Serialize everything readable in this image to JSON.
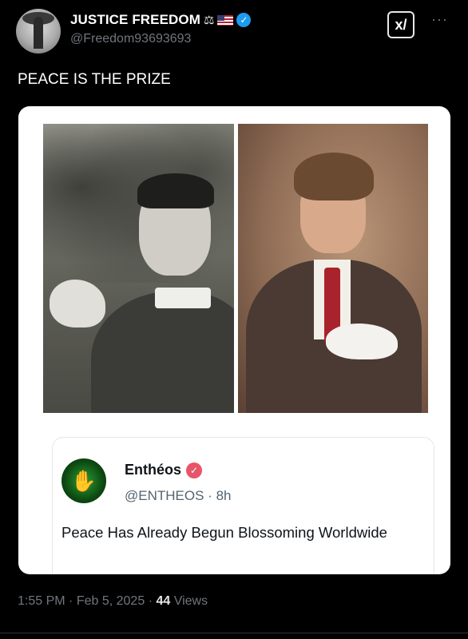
{
  "author": {
    "name": "JUSTICE FREEDOM",
    "name_emojis": [
      "scales-icon",
      "us-flag-icon"
    ],
    "handle": "@Freedom93693693",
    "verified": true,
    "verified_color": "#1d9bf0"
  },
  "header_actions": {
    "grok_label": "x/",
    "more_label": "···"
  },
  "tweet": {
    "text": "PEACE IS THE PRIZE",
    "images": [
      "portrait-man-with-dove-bw",
      "portrait-man-in-suit-with-dove"
    ]
  },
  "quoted": {
    "name": "Enthéos",
    "handle": "@ENTHEOS",
    "time": "8h",
    "separator": "·",
    "badge_color": "#e8556a",
    "text": "Peace Has Already Begun Blossoming Worldwide"
  },
  "footer": {
    "time": "1:55 PM",
    "date": "Feb 5, 2025",
    "views_count": "44",
    "views_label": "Views",
    "separator": "·"
  }
}
